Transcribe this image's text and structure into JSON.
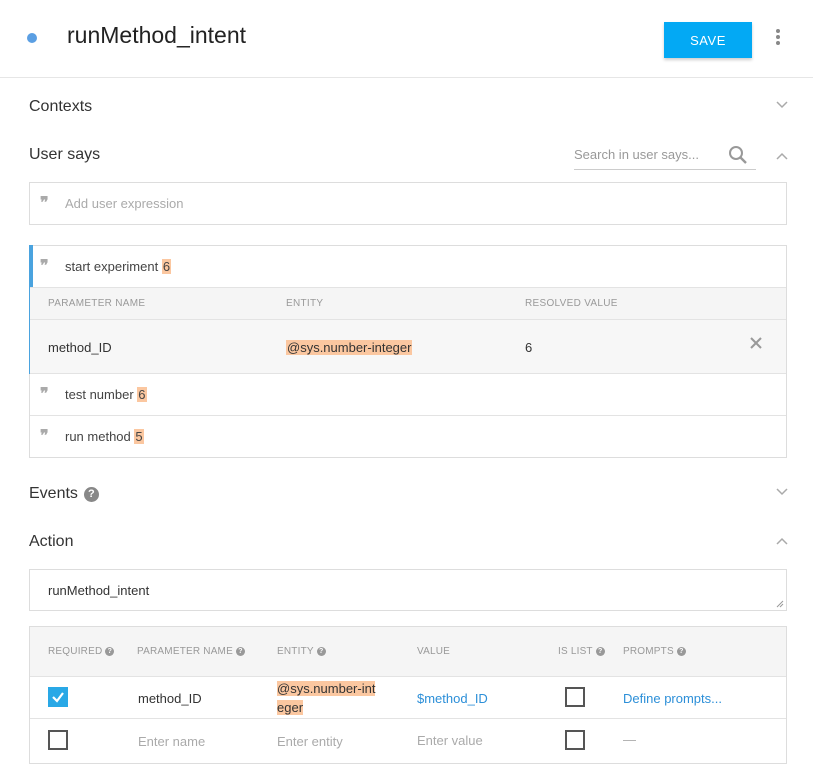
{
  "header": {
    "title": "runMethod_intent",
    "save_label": "SAVE"
  },
  "contexts": {
    "title": "Contexts"
  },
  "user_says": {
    "title": "User says",
    "search_placeholder": "Search in user says...",
    "add_placeholder": "Add user expression",
    "expressions": [
      {
        "text": "start experiment ",
        "highlight": "6"
      },
      {
        "text": "test number ",
        "highlight": "6"
      },
      {
        "text": "run method ",
        "highlight": "5"
      }
    ],
    "param_headers": {
      "name": "PARAMETER NAME",
      "entity": "ENTITY",
      "resolved": "RESOLVED VALUE"
    },
    "param_row": {
      "name": "method_ID",
      "entity": "@sys.number-integer",
      "resolved": "6"
    }
  },
  "events": {
    "title": "Events"
  },
  "action": {
    "title": "Action",
    "value": "runMethod_intent",
    "table_headers": {
      "required": "REQUIRED",
      "param_name": "PARAMETER NAME",
      "entity": "ENTITY",
      "value": "VALUE",
      "is_list": "IS LIST",
      "prompts": "PROMPTS"
    },
    "rows": [
      {
        "required": true,
        "name": "method_ID",
        "entity_line1": "@sys.number-int",
        "entity_line2": "eger",
        "value": "$method_ID",
        "is_list": false,
        "prompts": "Define prompts..."
      }
    ],
    "empty_row": {
      "name_placeholder": "Enter name",
      "entity_placeholder": "Enter entity",
      "value_placeholder": "Enter value",
      "prompts": "—"
    }
  }
}
